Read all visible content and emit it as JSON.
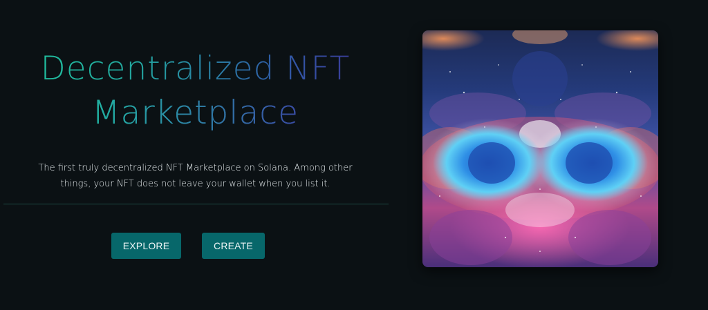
{
  "hero": {
    "title_line1": "Decentralized NFT",
    "title_line2": "Marketplace",
    "description": "The first truly decentralized NFT Marketplace on Solana. Among other things, your NFT does not leave your wallet when you list it."
  },
  "buttons": {
    "explore_label": "EXPLORE",
    "create_label": "CREATE"
  },
  "colors": {
    "background": "#0b1114",
    "button": "#07676a",
    "title_gradient_start": "#1fc39a",
    "title_gradient_end": "#402d93",
    "divider": "#1d4a44"
  },
  "featured_art": {
    "icon": "nft-artwork-image"
  }
}
